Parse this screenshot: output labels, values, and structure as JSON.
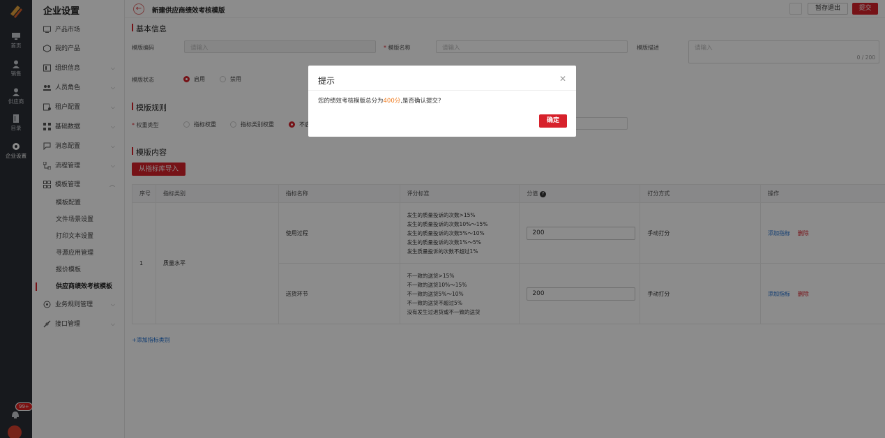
{
  "rail": {
    "items": [
      {
        "label": "首页",
        "icon": "monitor-icon"
      },
      {
        "label": "销售",
        "icon": "person-icon"
      },
      {
        "label": "供应商",
        "icon": "person-icon"
      },
      {
        "label": "目录",
        "icon": "book-icon"
      },
      {
        "label": "企业设置",
        "icon": "gear-icon",
        "active": true
      }
    ],
    "badge": "99+"
  },
  "sidebar": {
    "title": "企业设置",
    "items": [
      {
        "label": "产品市场",
        "icon": "monitor-icon",
        "expandable": false
      },
      {
        "label": "我的产品",
        "icon": "box-icon",
        "expandable": false
      },
      {
        "label": "组织信息",
        "icon": "org-icon",
        "expandable": true
      },
      {
        "label": "人员角色",
        "icon": "people-icon",
        "expandable": true
      },
      {
        "label": "租户配置",
        "icon": "tenant-icon",
        "expandable": true
      },
      {
        "label": "基础数据",
        "icon": "data-icon",
        "expandable": true
      },
      {
        "label": "消息配置",
        "icon": "message-icon",
        "expandable": true
      },
      {
        "label": "流程管理",
        "icon": "flow-icon",
        "expandable": true
      },
      {
        "label": "模板管理",
        "icon": "template-icon",
        "expandable": true,
        "expanded": true
      }
    ],
    "sub_items": [
      {
        "label": "模板配置"
      },
      {
        "label": "文件场景设置"
      },
      {
        "label": "打印文本设置"
      },
      {
        "label": "寻源应用管理"
      },
      {
        "label": "报价模板"
      },
      {
        "label": "供应商绩效考核模板",
        "active": true
      }
    ],
    "tail_items": [
      {
        "label": "业务规则管理",
        "icon": "rules-icon"
      },
      {
        "label": "接口管理",
        "icon": "api-icon"
      }
    ]
  },
  "header": {
    "title": "新建供应商绩效考核模版",
    "draft_label": "暂存退出",
    "submit_label": "提交"
  },
  "basic": {
    "section": "基本信息",
    "code_label": "模版编码",
    "code_placeholder": "请输入",
    "name_label": "模版名称",
    "name_placeholder": "请输入",
    "desc_label": "模版描述",
    "desc_placeholder": "请输入",
    "desc_count": "0 / 200",
    "status_label": "模版状态",
    "status_on": "启用",
    "status_off": "禁用"
  },
  "rules": {
    "section": "模版规则",
    "weight_label": "权重类型",
    "options": [
      "指标权重",
      "指标类别权重",
      "不启用"
    ],
    "selected": "不启用"
  },
  "content": {
    "section": "模版内容",
    "import_label": "从指标库导入",
    "columns": [
      "序号",
      "指标类别",
      "指标名称",
      "评分标准",
      "分值",
      "打分方式",
      "操作"
    ],
    "rows": [
      {
        "index": "1",
        "category": "质量水平",
        "indicators": [
          {
            "name": "使用过程",
            "standards": [
              "发生的质量投诉的次数>15%",
              "发生的质量投诉的次数10%～15%",
              "发生的质量投诉的次数5%～10%",
              "发生的质量投诉的次数1%～5%",
              "发生质量投诉的次数不超过1%"
            ],
            "score": "200",
            "method": "手动打分",
            "op_add": "添加指标",
            "op_delete": "删除"
          },
          {
            "name": "送货环节",
            "standards": [
              "不一致的送货>15%",
              "不一致的送货10%～15%",
              "不一致的送货5%～10%",
              "不一致的送货不超过5%",
              "没有发生过退货或不一致的送货"
            ],
            "score": "200",
            "method": "手动打分",
            "op_add": "添加指标",
            "op_delete": "删除"
          }
        ]
      }
    ],
    "add_category_label": "+添加指标类别"
  },
  "modal": {
    "title": "提示",
    "message_prefix": "您的绩效考核模版总分为",
    "message_highlight": "400分",
    "message_suffix": ",是否确认提交?",
    "ok_label": "确定"
  },
  "colors": {
    "brand": "#d7212b",
    "highlight": "#f07c20",
    "link": "#1f6fd0"
  }
}
